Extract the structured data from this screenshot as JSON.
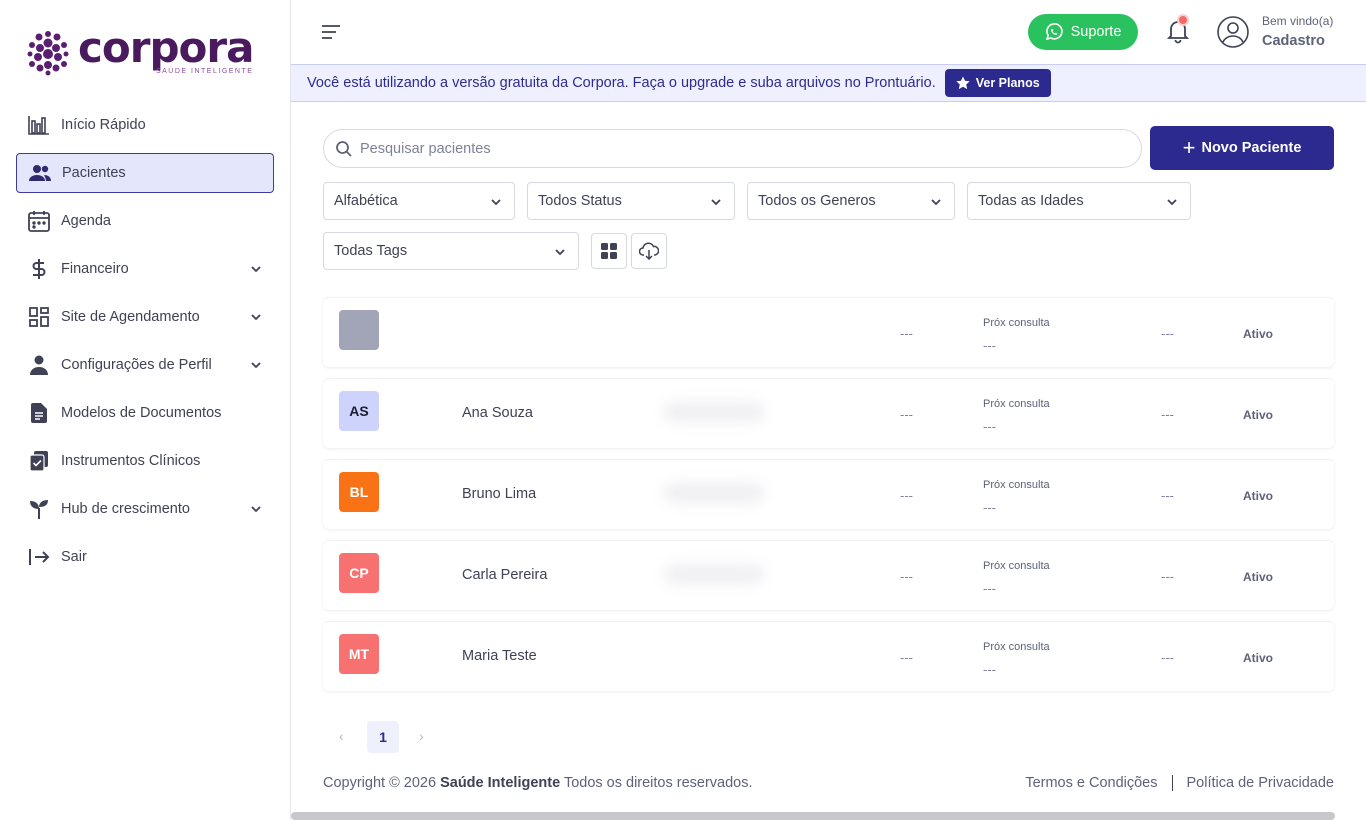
{
  "brand": {
    "name": "corpora",
    "tagline": "SAÚDE INTELIGENTE",
    "color": "#4a1a5e"
  },
  "sidebar": {
    "items": [
      {
        "label": "Início Rápido",
        "icon": "chart-bars-icon"
      },
      {
        "label": "Pacientes",
        "icon": "users-icon",
        "active": true
      },
      {
        "label": "Agenda",
        "icon": "calendar-icon"
      },
      {
        "label": "Financeiro",
        "icon": "dollar-icon",
        "expandable": true
      },
      {
        "label": "Site de Agendamento",
        "icon": "grid-icon",
        "expandable": true
      },
      {
        "label": "Configurações de Perfil",
        "icon": "person-icon",
        "expandable": true
      },
      {
        "label": "Modelos de Documentos",
        "icon": "document-icon"
      },
      {
        "label": "Instrumentos Clínicos",
        "icon": "clipboard-icon"
      },
      {
        "label": "Hub de crescimento",
        "icon": "sprout-icon",
        "expandable": true
      },
      {
        "label": "Sair",
        "icon": "logout-icon"
      }
    ]
  },
  "header": {
    "support_label": "Suporte",
    "greeting": "Bem vindo(a)",
    "user_name": "Cadastro"
  },
  "banner": {
    "text": "Você está utilizando a versão gratuita da Corpora. Faça o upgrade e suba arquivos no Prontuário.",
    "button_label": "Ver Planos"
  },
  "search": {
    "placeholder": "Pesquisar pacientes",
    "value": ""
  },
  "new_patient_label": "Novo Paciente",
  "filters": {
    "sort": "Alfabética",
    "status": "Todos Status",
    "gender": "Todos os Generos",
    "age": "Todas as Idades",
    "tags": "Todas Tags"
  },
  "patients": [
    {
      "initials": "",
      "name": "",
      "bg": "#a1a5b7",
      "fg": "#ffffff",
      "col1": "---",
      "next_label": "Próx consulta",
      "next_value": "---",
      "col3": "---",
      "status": "Ativo",
      "blurred": false
    },
    {
      "initials": "AS",
      "name": "Ana Souza",
      "bg": "#cdd3fb",
      "fg": "#1e1e2d",
      "col1": "---",
      "next_label": "Próx consulta",
      "next_value": "---",
      "col3": "---",
      "status": "Ativo",
      "blurred": true
    },
    {
      "initials": "BL",
      "name": "Bruno Lima",
      "bg": "#f97316",
      "fg": "#ffffff",
      "col1": "---",
      "next_label": "Próx consulta",
      "next_value": "---",
      "col3": "---",
      "status": "Ativo",
      "blurred": true
    },
    {
      "initials": "CP",
      "name": "Carla Pereira",
      "bg": "#f87171",
      "fg": "#ffffff",
      "col1": "---",
      "next_label": "Próx consulta",
      "next_value": "---",
      "col3": "---",
      "status": "Ativo",
      "blurred": true
    },
    {
      "initials": "MT",
      "name": "Maria Teste",
      "bg": "#f87171",
      "fg": "#ffffff",
      "col1": "---",
      "next_label": "Próx consulta",
      "next_value": "---",
      "col3": "---",
      "status": "Ativo",
      "blurred": false
    }
  ],
  "pagination": {
    "prev": "‹",
    "current": "1",
    "next": "›"
  },
  "footer": {
    "copyright_prefix": "Copyright © 2026",
    "company": "Saúde Inteligente",
    "rights": "Todos os direitos reservados.",
    "terms": "Termos e Condições",
    "privacy": "Política de Privacidade"
  },
  "colors": {
    "primary": "#2d2a8f",
    "support_green": "#29c25f",
    "banner_bg": "#eef0ff"
  }
}
